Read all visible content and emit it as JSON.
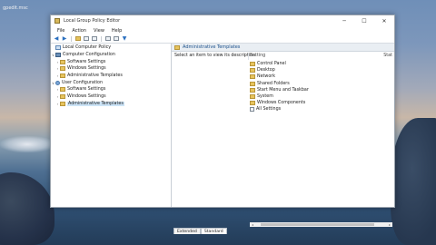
{
  "desktop": {
    "label": "gpedit.msc"
  },
  "window": {
    "title": "Local Group Policy Editor",
    "controls": {
      "minimize": "─",
      "maximize": "☐",
      "close": "✕"
    }
  },
  "menu": [
    "File",
    "Action",
    "View",
    "Help"
  ],
  "toolbar": {
    "back": "◀",
    "forward": "▶"
  },
  "tree": {
    "root": "Local Computer Policy",
    "computer_config": "Computer Configuration",
    "cc_software": "Software Settings",
    "cc_windows": "Windows Settings",
    "cc_admin": "Administrative Templates",
    "user_config": "User Configuration",
    "uc_software": "Software Settings",
    "uc_windows": "Windows Settings",
    "uc_admin": "Administrative Templates"
  },
  "panel": {
    "header": "Administrative Templates",
    "description": "Select an item to view its description.",
    "col_setting": "Setting",
    "col_state": "Stat"
  },
  "items": [
    {
      "label": "Control Panel",
      "icon": "folder-icon"
    },
    {
      "label": "Desktop",
      "icon": "folder-icon"
    },
    {
      "label": "Network",
      "icon": "folder-icon"
    },
    {
      "label": "Shared Folders",
      "icon": "folder-icon"
    },
    {
      "label": "Start Menu and Taskbar",
      "icon": "folder-icon"
    },
    {
      "label": "System",
      "icon": "folder-icon"
    },
    {
      "label": "Windows Components",
      "icon": "folder-icon"
    },
    {
      "label": "All Settings",
      "icon": "settings-list-icon"
    }
  ],
  "tabs": {
    "extended": "Extended",
    "standard": "Standard"
  }
}
